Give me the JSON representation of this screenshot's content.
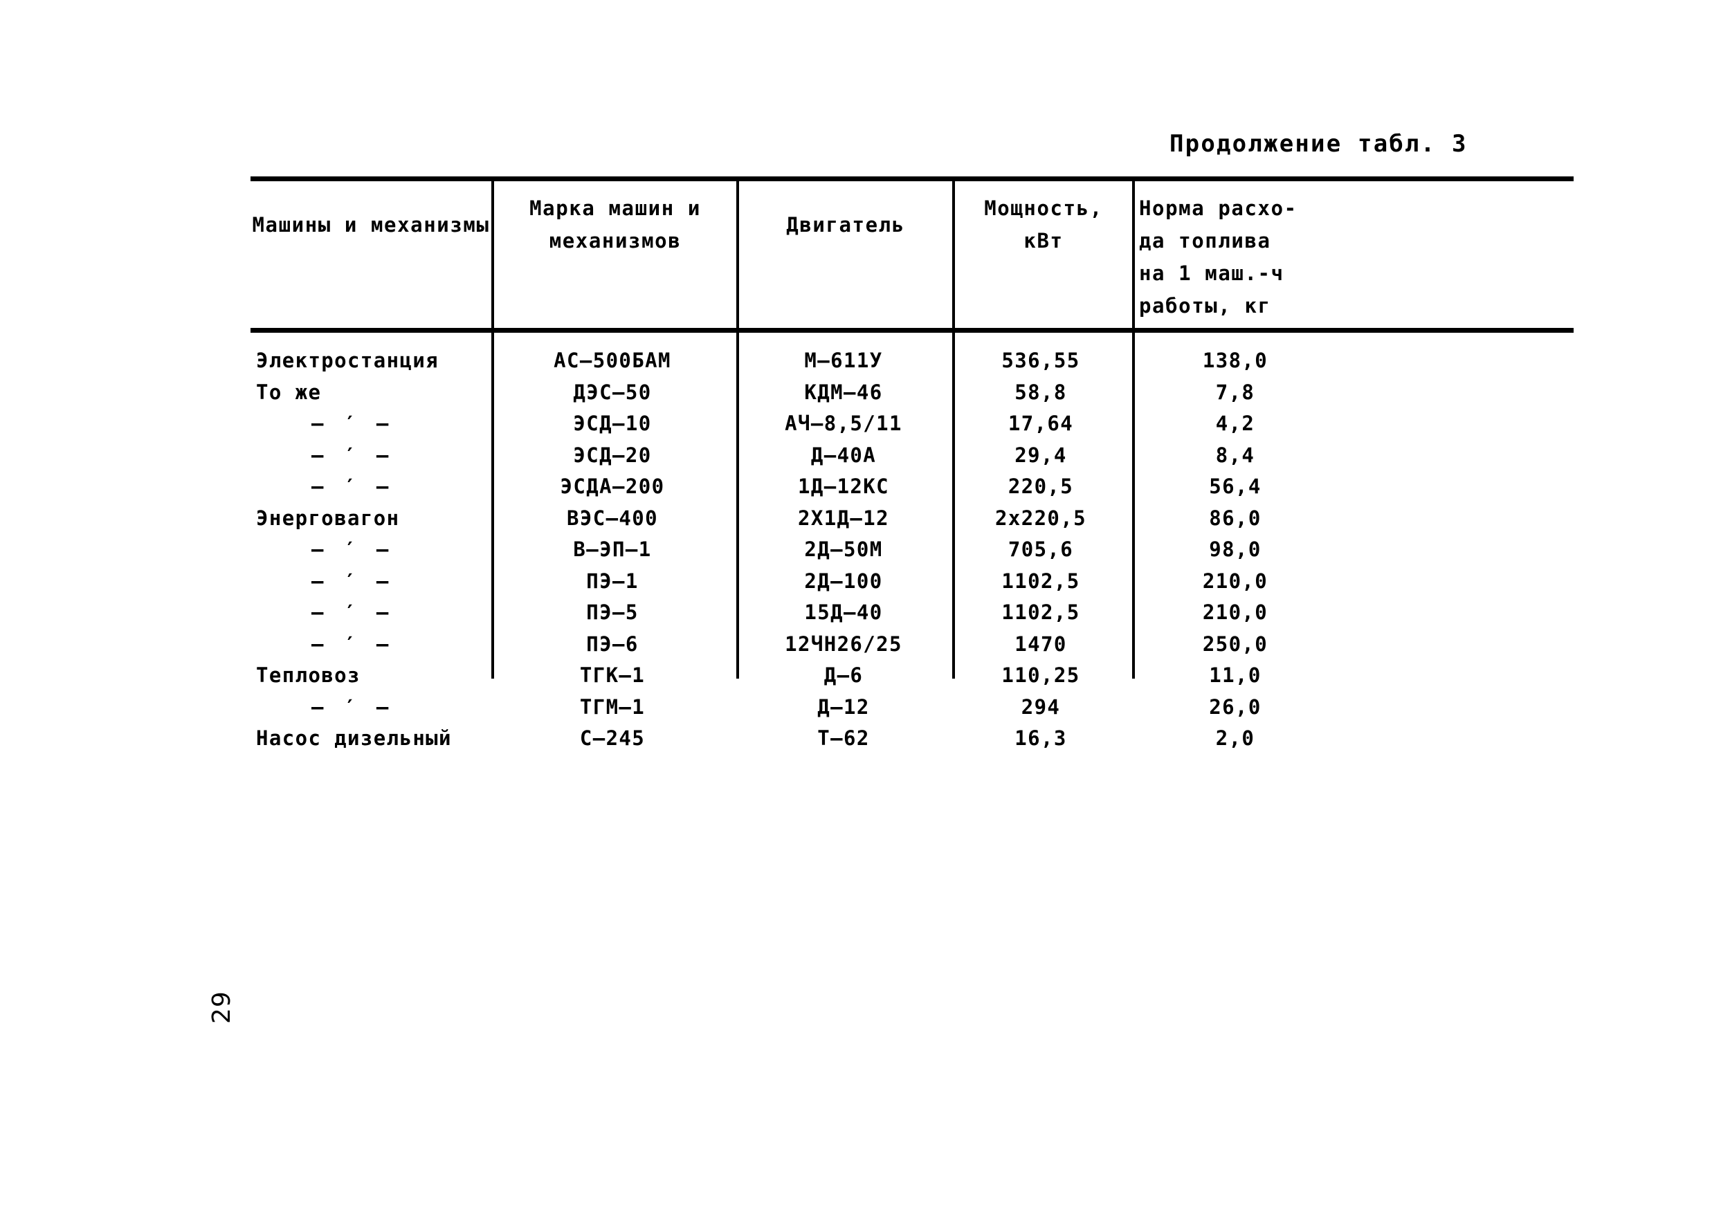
{
  "document": {
    "caption": "Продолжение табл. 3",
    "page_number": "29"
  },
  "table": {
    "columns": [
      {
        "key": "name",
        "header": "Машины и механизмы"
      },
      {
        "key": "mark",
        "header_line1": "Марка машин и",
        "header_line2": "механизмов"
      },
      {
        "key": "engine",
        "header": "Двигатель"
      },
      {
        "key": "power",
        "header_line1": "Мощность,",
        "header_line2": "кВт"
      },
      {
        "key": "fuel",
        "header_line1": "Норма расхо-",
        "header_line2": "да топлива",
        "header_line3": "на 1 маш.-ч",
        "header_line4": "работы, кг"
      }
    ],
    "rows": [
      {
        "name": "Электростанция",
        "mark": "АС–500БАМ",
        "engine": "М–611У",
        "power": "536,55",
        "fuel": "138,0"
      },
      {
        "name": "То же",
        "mark": "ДЭС–50",
        "engine": "КДМ–46",
        "power": "58,8",
        "fuel": "7,8"
      },
      {
        "name": "– ′ –",
        "mark": "ЭСД–10",
        "engine": "АЧ–8,5/11",
        "power": "17,64",
        "fuel": "4,2"
      },
      {
        "name": "– ′ –",
        "mark": "ЭСД–20",
        "engine": "Д–40А",
        "power": "29,4",
        "fuel": "8,4"
      },
      {
        "name": "– ′ –",
        "mark": "ЭСДА–200",
        "engine": "1Д–12КС",
        "power": "220,5",
        "fuel": "56,4"
      },
      {
        "name": "Энерговагон",
        "mark": "ВЭС–400",
        "engine": "2Х1Д–12",
        "power": "2x220,5",
        "fuel": "86,0"
      },
      {
        "name": "– ′ –",
        "mark": "В–ЭП–1",
        "engine": "2Д–50М",
        "power": "705,6",
        "fuel": "98,0"
      },
      {
        "name": "– ′ –",
        "mark": "ПЭ–1",
        "engine": "2Д–100",
        "power": "1102,5",
        "fuel": "210,0"
      },
      {
        "name": "– ′ –",
        "mark": "ПЭ–5",
        "engine": "15Д–40",
        "power": "1102,5",
        "fuel": "210,0"
      },
      {
        "name": "– ′ –",
        "mark": "ПЭ–6",
        "engine": "12ЧН26/25",
        "power": "1470",
        "fuel": "250,0"
      },
      {
        "name": "Тепловоз",
        "mark": "ТГК–1",
        "engine": "Д–6",
        "power": "110,25",
        "fuel": "11,0"
      },
      {
        "name": "– ′ –",
        "mark": "ТГМ–1",
        "engine": "Д–12",
        "power": "294",
        "fuel": "26,0"
      },
      {
        "name": "Насос дизельный",
        "mark": "С–245",
        "engine": "Т–62",
        "power": "16,3",
        "fuel": "2,0"
      }
    ]
  }
}
